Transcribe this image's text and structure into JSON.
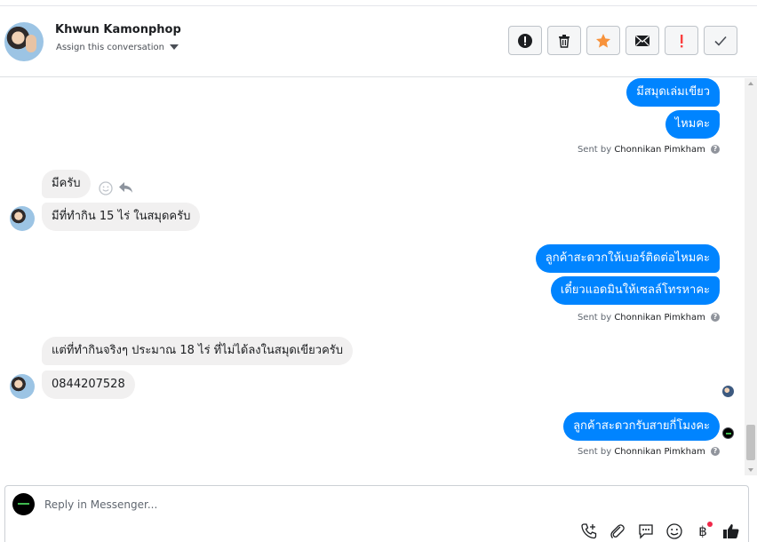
{
  "header": {
    "name": "Khwun Kamonphop",
    "assign_label": "Assign this conversation",
    "colors": {
      "star": "#f7923b",
      "important": "#fa3e3e"
    }
  },
  "messages": {
    "out_1": "มีสมุดเล่มเขียว",
    "out_2": "ไหมคะ",
    "sent_by_1": "Sent by",
    "sender_1": "Chonnikan Pimkham",
    "in_1": "มีครับ",
    "in_2": "มีที่ทำกิน 15 ไร่ ในสมุดครับ",
    "out_3": "ลูกค้าสะดวกให้เบอร์ติดต่อไหมคะ",
    "out_4": "เดี๋ยวแอดมินให้เซลล์โทรหาคะ",
    "sent_by_2": "Sent by",
    "sender_2": "Chonnikan Pimkham",
    "in_3": "แต่ที่ทำกินจริงๆ ประมาณ 18 ไร่ ที่ไม่ได้ลงในสมุดเขียวครับ",
    "in_4": "0844207528",
    "out_5": "ลูกค้าสะดวกรับสายกี่โมงคะ",
    "sent_by_3": "Sent by",
    "sender_3": "Chonnikan Pimkham",
    "colors": {
      "outgoing": "#0084ff",
      "incoming": "#f1f0f0"
    }
  },
  "composer": {
    "placeholder": "Reply in Messenger...",
    "currency_symbol": "฿"
  }
}
